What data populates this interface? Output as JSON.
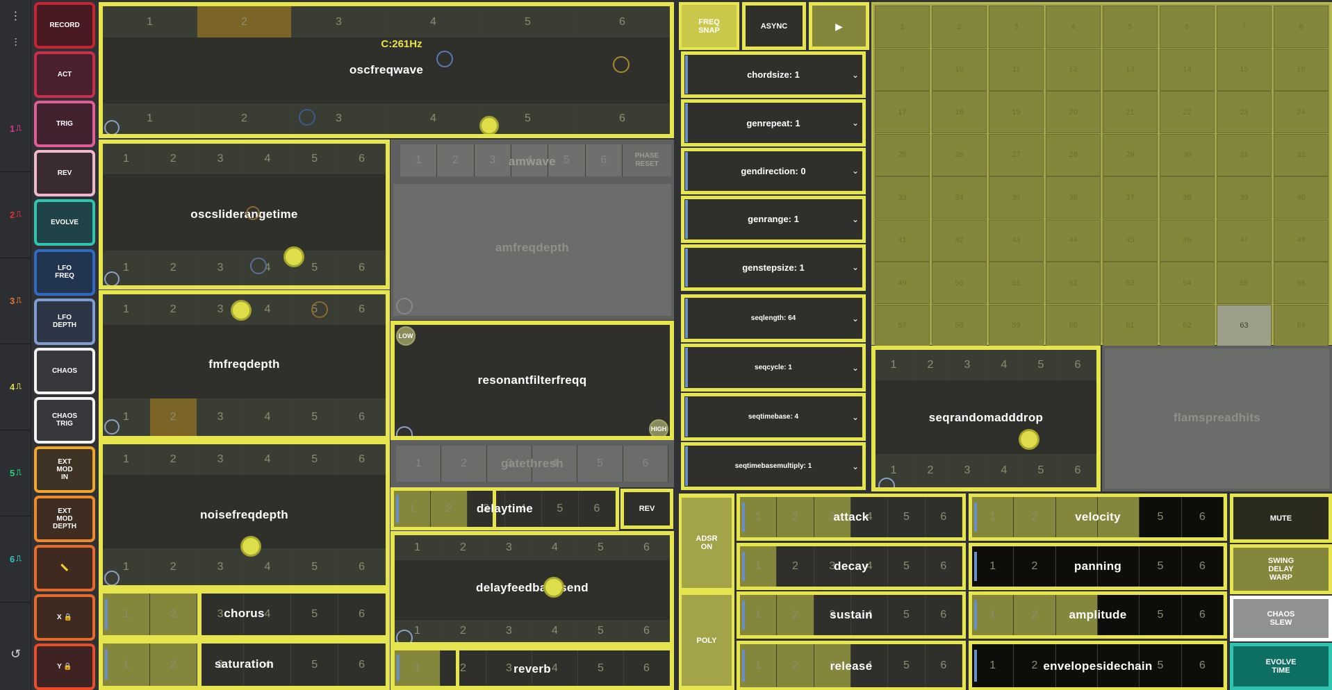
{
  "rail": {
    "top": [
      "⋮",
      "⫶"
    ],
    "items": [
      {
        "num": "1",
        "color": "#e0358d"
      },
      {
        "num": "2",
        "color": "#e0303a"
      },
      {
        "num": "3",
        "color": "#e8782e"
      },
      {
        "num": "4",
        "color": "#e0d84a"
      },
      {
        "num": "5",
        "color": "#2ad07c"
      },
      {
        "num": "6",
        "color": "#2fc7bd"
      }
    ],
    "undo": "↺"
  },
  "left": [
    {
      "label": "RECORD",
      "border": "#c52430",
      "bg": "#4a1a22"
    },
    {
      "label": "ACT",
      "border": "#c92f4a",
      "bg": "#4a1f2e"
    },
    {
      "label": "TRIG",
      "border": "#e25c98",
      "bg": "#43222f"
    },
    {
      "label": "REV",
      "border": "#f0b9cb",
      "bg": "#3a2c31"
    },
    {
      "label": "EVOLVE",
      "border": "#2fc4b0",
      "bg": "#1f4347"
    },
    {
      "label": "LFO\nFREQ",
      "border": "#2f6bc4",
      "bg": "#223550"
    },
    {
      "label": "LFO\nDEPTH",
      "border": "#7e9ed2",
      "bg": "#2c3646"
    },
    {
      "label": "CHAOS",
      "border": "#f2f2f2",
      "bg": "#36383c"
    },
    {
      "label": "CHAOS\nTRIG",
      "border": "#f2f2f2",
      "bg": "#36383c"
    },
    {
      "label": "EXT\nMOD\nIN",
      "border": "#f0a628",
      "bg": "#3f3325"
    },
    {
      "label": "EXT\nMOD\nDEPTH",
      "border": "#f08a28",
      "bg": "#3f2d22"
    },
    {
      "label": "📏",
      "border": "#e96a28",
      "bg": "#3f2a22"
    },
    {
      "label": "X 🔒",
      "border": "#e96a28",
      "bg": "#3f2a22"
    },
    {
      "label": "Y 🔒",
      "border": "#e84c28",
      "bg": "#3f2222"
    }
  ],
  "seg": [
    "1",
    "2",
    "3",
    "4",
    "5",
    "6"
  ],
  "modules": {
    "oscfreqwave": "oscfreqwave",
    "freq_readout": "C:261Hz",
    "oscsliderangetime": "oscsliderangetime",
    "fmfreqdepth": "fmfreqdepth",
    "noisefreqdepth": "noisefreqdepth",
    "chorus": "chorus",
    "saturation": "saturation",
    "amwave": "amwave",
    "phase_reset": "PHASE\nRESET",
    "amfreqdepth": "amfreqdepth",
    "resonantfilterfreqq": "resonantfilterfreqq",
    "low": "LOW",
    "high": "HIGH",
    "gatethresh": "gatethresh",
    "delaytime": "delaytime",
    "rev": "REV",
    "delayfeedbacksend": "delayfeedbacksend",
    "reverb": "reverb",
    "seqrandomadddrop": "seqrandomadddrop",
    "flamspreadhits": "flamspreadhits"
  },
  "top_buttons": {
    "freq_snap": "FREQ\nSNAP",
    "async": "ASYNC",
    "play": "▶"
  },
  "dropdowns1": [
    "chordsize: 1",
    "genrepeat: 1",
    "gendirection: 0",
    "genrange: 1",
    "genstepsize: 1"
  ],
  "dropdowns2": [
    "seqlength: 64",
    "seqcycle: 1",
    "seqtimebase: 4",
    "seqtimebasemultiply: 1"
  ],
  "grid": {
    "cells": 64,
    "selected": 63
  },
  "adsr": {
    "adsr_on": "ADSR\nON",
    "poly": "POLY",
    "attack": "attack",
    "decay": "decay",
    "sustain": "sustain",
    "release": "release"
  },
  "amp": {
    "velocity": "velocity",
    "panning": "panning",
    "amplitude": "amplitude",
    "envelopesidechain": "envelopesidechain"
  },
  "right_buttons": {
    "mute": "MUTE",
    "swing": "SWING\nDELAY\nWARP",
    "chaos_slew": "CHAOS\nSLEW",
    "evolve_time": "EVOLVE\nTIME"
  }
}
